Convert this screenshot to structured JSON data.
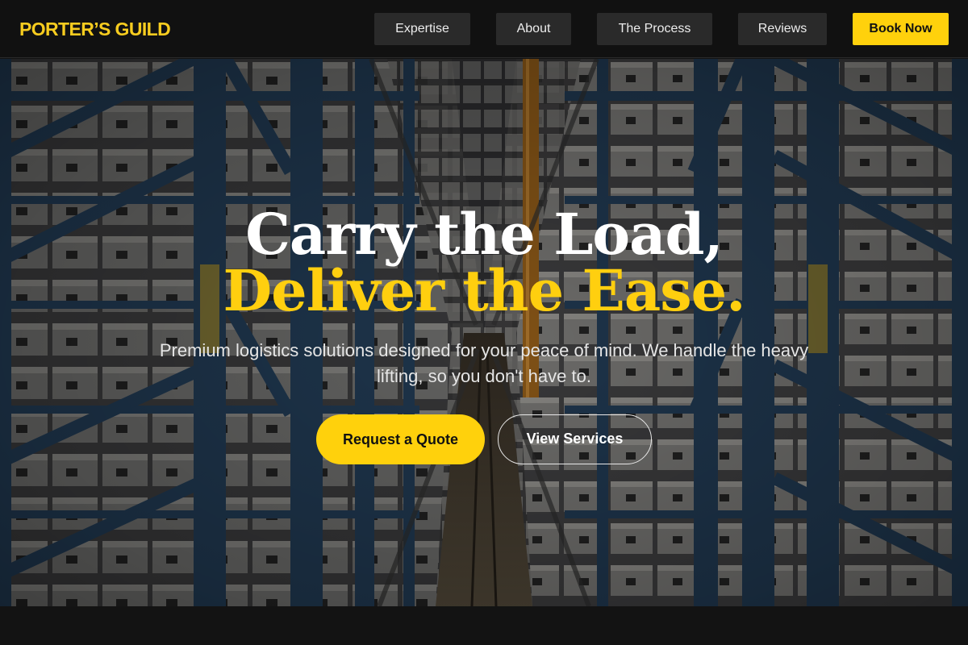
{
  "header": {
    "logo": "PORTER’S GUILD",
    "nav": [
      {
        "label": "Expertise"
      },
      {
        "label": "About"
      },
      {
        "label": "The Process"
      },
      {
        "label": "Reviews"
      }
    ],
    "cta_label": "Book Now"
  },
  "hero": {
    "headline_line1": "Carry the Load,",
    "headline_line2": "Deliver the Ease.",
    "subtext": "Premium logistics solutions designed for your peace of mind. We handle the heavy lifting, so you don't have to.",
    "primary_button": "Request a Quote",
    "secondary_button": "View Services"
  },
  "colors": {
    "accent": "#ffd10c",
    "header_bg": "#111111",
    "nav_button_bg": "#2a2a2a",
    "hero_headline": "#ffffff"
  }
}
